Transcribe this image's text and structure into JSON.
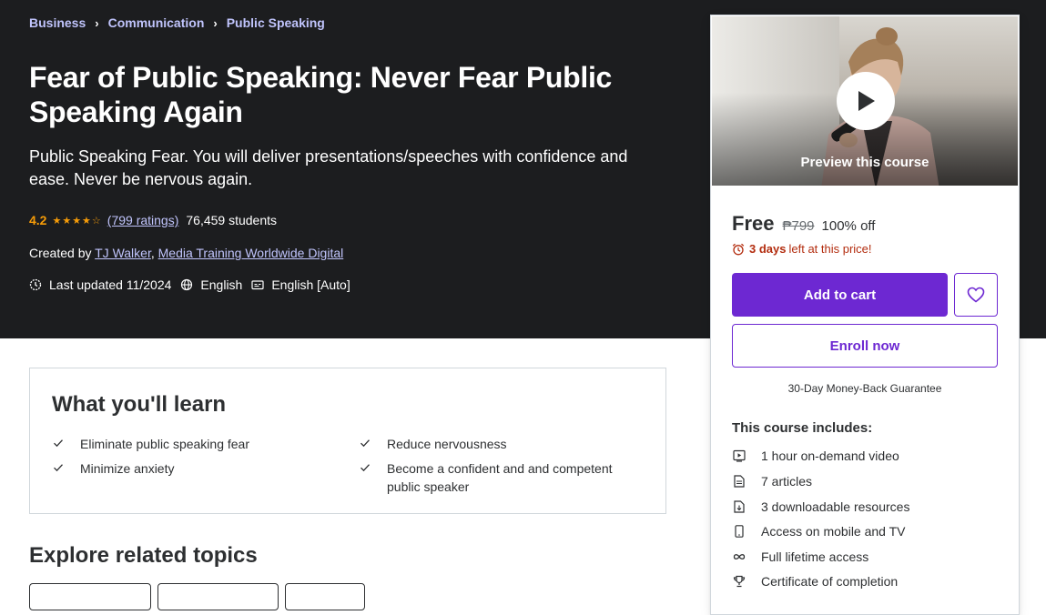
{
  "breadcrumb": [
    "Business",
    "Communication",
    "Public Speaking"
  ],
  "course": {
    "title": "Fear of Public Speaking: Never Fear Public Speaking Again",
    "subtitle": "Public Speaking Fear. You will deliver presentations/speeches with confidence and ease. Never be nervous again.",
    "rating": "4.2",
    "ratings_count": "(799 ratings)",
    "students": "76,459 students",
    "created_by_label": "Created by",
    "instructors": [
      "TJ Walker",
      "Media Training Worldwide Digital"
    ],
    "last_updated": "Last updated 11/2024",
    "language": "English",
    "captions": "English [Auto]"
  },
  "learn": {
    "title": "What you'll learn",
    "items": [
      "Eliminate public speaking fear",
      "Reduce nervousness",
      "Minimize anxiety",
      "Become a confident and and competent public speaker"
    ]
  },
  "related": {
    "title": "Explore related topics"
  },
  "sidebar": {
    "preview_label": "Preview this course",
    "price": "Free",
    "original_price": "₱799",
    "discount": "100% off",
    "countdown_bold": "3 days",
    "countdown_rest": "left at this price!",
    "add_to_cart": "Add to cart",
    "enroll": "Enroll now",
    "guarantee": "30-Day Money-Back Guarantee",
    "includes_title": "This course includes:",
    "includes": [
      {
        "icon": "video-icon",
        "label": "1 hour on-demand video"
      },
      {
        "icon": "article-icon",
        "label": "7 articles"
      },
      {
        "icon": "download-icon",
        "label": "3 downloadable resources"
      },
      {
        "icon": "mobile-icon",
        "label": "Access on mobile and TV"
      },
      {
        "icon": "infinity-icon",
        "label": "Full lifetime access"
      },
      {
        "icon": "trophy-icon",
        "label": "Certificate of completion"
      }
    ]
  },
  "colors": {
    "hero_bg": "#1c1d1f",
    "accent": "#6d28d2",
    "link": "#c0c4fc",
    "star": "#f69c08",
    "urgent": "#b32d0f"
  }
}
